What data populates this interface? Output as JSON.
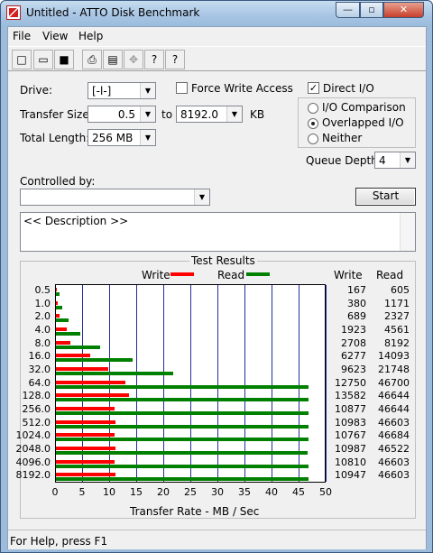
{
  "window": {
    "title": "Untitled - ATTO Disk Benchmark",
    "minimize": "—",
    "maximize": "▫",
    "close": "✕"
  },
  "menu": [
    "File",
    "View",
    "Help"
  ],
  "toolbar": {
    "new_icon": "new-file-icon",
    "open_icon": "open-folder-icon",
    "save_icon": "save-icon",
    "print_icon": "print-icon",
    "preview_icon": "print-preview-icon",
    "move_icon": "move-icon",
    "help_icon": "help-icon",
    "context_help_icon": "context-help-icon"
  },
  "form": {
    "drive_label": "Drive:",
    "drive_value": "[-l-]",
    "transfer_size_label": "Transfer Size:",
    "transfer_from": "0.5",
    "to_label": "to",
    "transfer_to": "8192.0",
    "kb_label": "KB",
    "total_length_label": "Total Length:",
    "total_length_value": "256 MB",
    "force_write_label": "Force Write Access",
    "direct_io_label": "Direct I/O",
    "io_comparison_label": "I/O Comparison",
    "overlapped_io_label": "Overlapped I/O",
    "neither_label": "Neither",
    "queue_depth_label": "Queue Depth:",
    "queue_depth_value": "4",
    "controlled_by_label": "Controlled by:",
    "controlled_by_value": "",
    "start_label": "Start",
    "description_text": "<< Description >>"
  },
  "status": {
    "text": "For Help, press F1"
  },
  "chart_data": {
    "type": "bar",
    "title": "Test Results",
    "xlabel": "Transfer Rate - MB / Sec",
    "xlim": [
      0,
      50
    ],
    "xticks": [
      0,
      5,
      10,
      15,
      20,
      25,
      30,
      35,
      40,
      45,
      50
    ],
    "legend": [
      {
        "name": "Write",
        "color": "#ff0000"
      },
      {
        "name": "Read",
        "color": "#008000"
      }
    ],
    "column_headers": [
      "Write",
      "Read"
    ],
    "categories": [
      "0.5",
      "1.0",
      "2.0",
      "4.0",
      "8.0",
      "16.0",
      "32.0",
      "64.0",
      "128.0",
      "256.0",
      "512.0",
      "1024.0",
      "2048.0",
      "4096.0",
      "8192.0"
    ],
    "series": [
      {
        "name": "Write",
        "values": [
          167,
          380,
          689,
          1923,
          2708,
          6277,
          9623,
          12750,
          13582,
          10877,
          10983,
          10767,
          10987,
          10810,
          10947
        ]
      },
      {
        "name": "Read",
        "values": [
          605,
          1171,
          2327,
          4561,
          8192,
          14093,
          21748,
          46700,
          46644,
          46644,
          46603,
          46684,
          46522,
          46603,
          46603
        ]
      }
    ]
  }
}
